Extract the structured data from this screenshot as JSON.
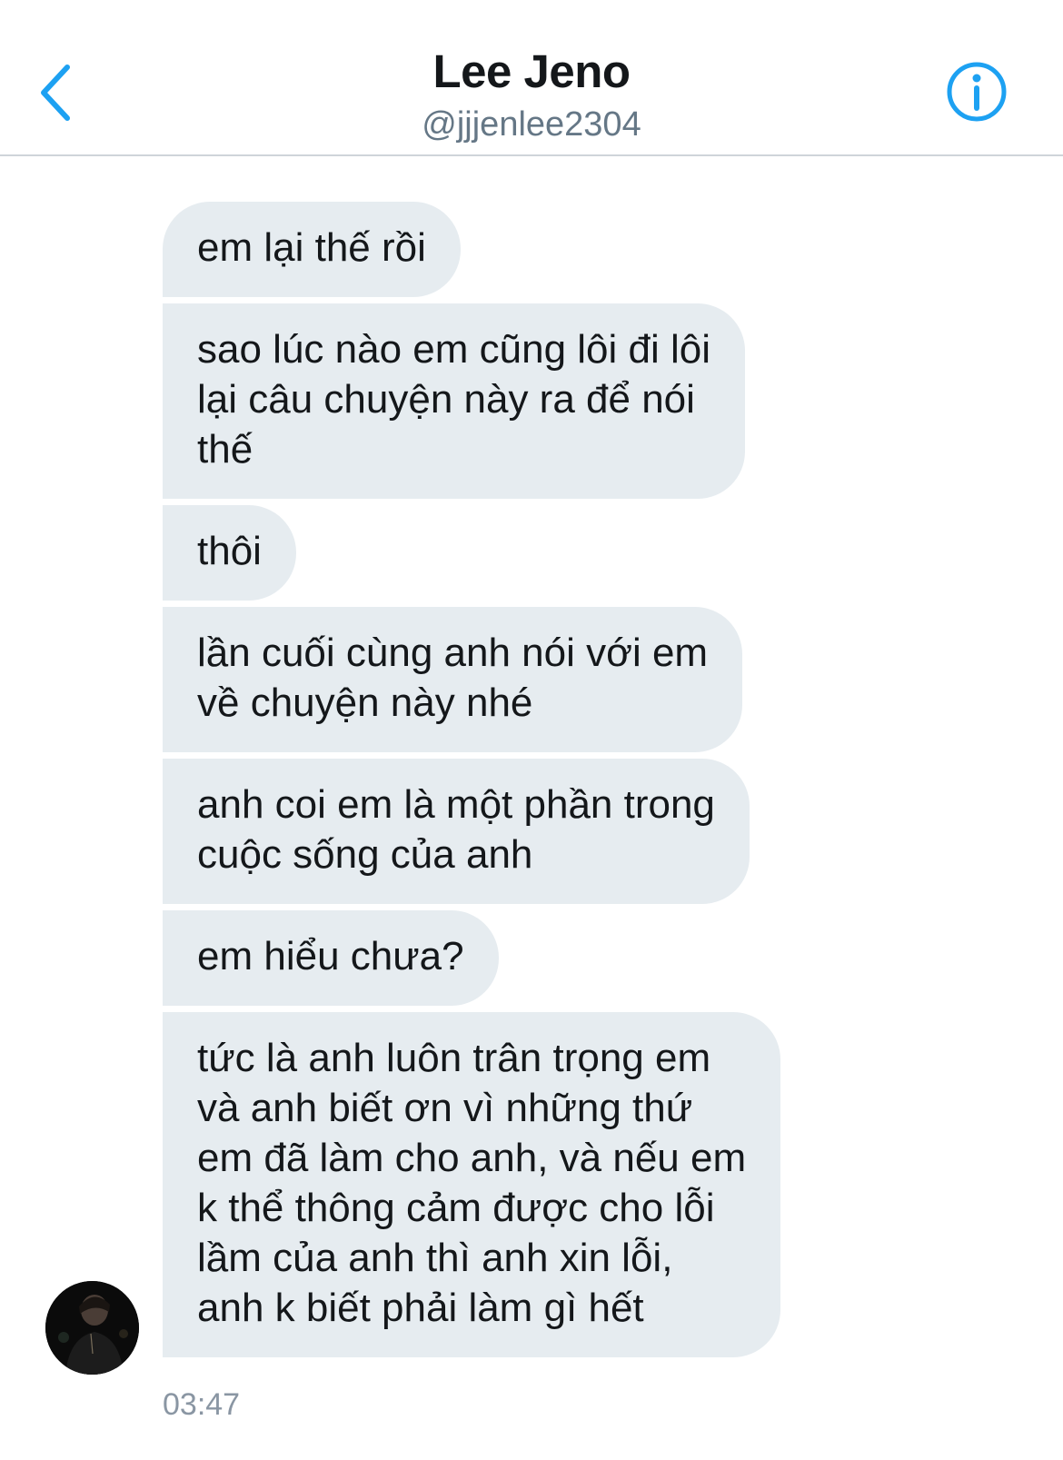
{
  "header": {
    "name": "Lee Jeno",
    "handle": "@jjjenlee2304",
    "back_icon": "chevron-left-icon",
    "info_icon": "info-circle-icon",
    "accent_color": "#1da1f2"
  },
  "messages": [
    {
      "text": "em lại thế rồi"
    },
    {
      "text": "sao lúc nào em cũng lôi đi lôi\nlại câu chuyện này ra để nói\nthế"
    },
    {
      "text": "thôi"
    },
    {
      "text": "lần cuối cùng anh nói với em\nvề chuyện này nhé"
    },
    {
      "text": "anh coi em là một phần trong\ncuộc sống của anh"
    },
    {
      "text": "em hiểu chưa?"
    },
    {
      "text": "tức là anh luôn trân trọng em\nvà anh biết ơn vì những thứ\nem đã làm cho anh, và nếu em\nk thể thông cảm được cho lỗi\nlầm của anh thì anh xin lỗi,\nanh k biết phải làm gì hết"
    }
  ],
  "timestamp": "03:47",
  "colors": {
    "bubble_bg": "#e6ecf0",
    "text": "#14171a",
    "muted": "#657786"
  }
}
